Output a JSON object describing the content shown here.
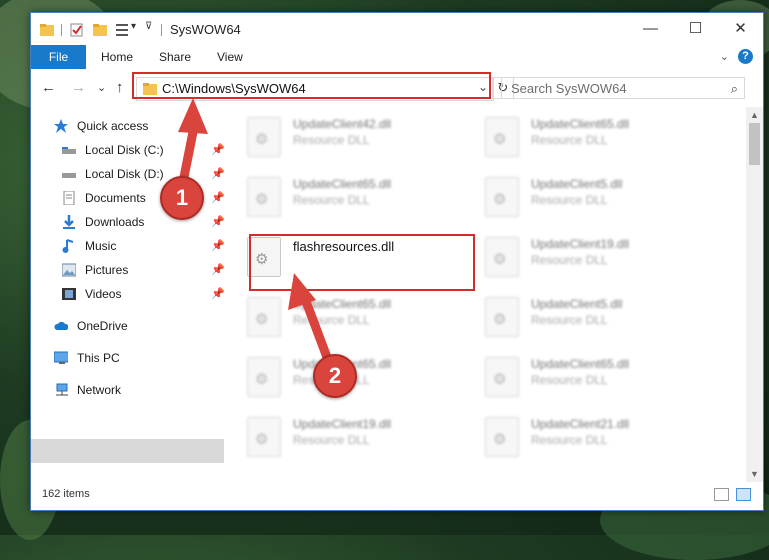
{
  "window": {
    "title": "SysWOW64",
    "min_glyph": "—",
    "max_glyph": "☐",
    "close_glyph": "✕"
  },
  "ribbon": {
    "tabs": [
      "File",
      "Home",
      "Share",
      "View"
    ],
    "help": "?",
    "collapse": "⌄"
  },
  "nav": {
    "back": "←",
    "forward": "→",
    "recent": "⌄",
    "up": "↑",
    "address": "C:\\Windows\\SysWOW64",
    "dropdown": "⌄",
    "refresh": "↻",
    "search_placeholder": "Search SysWOW64",
    "search_glyph": "⌕"
  },
  "sidebar": {
    "items": [
      {
        "label": "Quick access",
        "icon": "star-icon",
        "pinned": false
      },
      {
        "label": "Local Disk (C:)",
        "icon": "drive-icon",
        "pinned": true
      },
      {
        "label": "Local Disk (D:)",
        "icon": "drive-icon",
        "pinned": true
      },
      {
        "label": "Documents",
        "icon": "documents-icon",
        "pinned": true
      },
      {
        "label": "Downloads",
        "icon": "downloads-icon",
        "pinned": true
      },
      {
        "label": "Music",
        "icon": "music-icon",
        "pinned": true
      },
      {
        "label": "Pictures",
        "icon": "pictures-icon",
        "pinned": true
      },
      {
        "label": "Videos",
        "icon": "videos-icon",
        "pinned": true
      },
      {
        "label": "OneDrive",
        "icon": "cloud-icon",
        "pinned": false
      },
      {
        "label": "This PC",
        "icon": "computer-icon",
        "pinned": false,
        "selected": true
      },
      {
        "label": "Network",
        "icon": "network-icon",
        "pinned": false
      }
    ],
    "pin_glyph": "📌"
  },
  "files": [
    {
      "name": "UpdateClient42.dll",
      "type": "Resource DLL"
    },
    {
      "name": "UpdateClient65.dll",
      "type": "Resource DLL"
    },
    {
      "name": "UpdateClient65.dll",
      "type": "Resource DLL"
    },
    {
      "name": "UpdateClient5.dll",
      "type": "Resource DLL"
    },
    {
      "name": "flashresources.dll",
      "type": "",
      "highlight": true
    },
    {
      "name": "UpdateClient19.dll",
      "type": "Resource DLL"
    },
    {
      "name": "UpdateClient65.dll",
      "type": "Resource DLL"
    },
    {
      "name": "UpdateClient5.dll",
      "type": "Resource DLL"
    },
    {
      "name": "UpdateClient65.dll",
      "type": "Resource DLL"
    },
    {
      "name": "UpdateClient65.dll",
      "type": "Resource DLL"
    },
    {
      "name": "UpdateClient19.dll",
      "type": "Resource DLL"
    },
    {
      "name": "UpdateClient21.dll",
      "type": "Resource DLL"
    }
  ],
  "status": {
    "item_count": "162 items"
  },
  "callouts": [
    {
      "number": "1"
    },
    {
      "number": "2"
    }
  ],
  "colors": {
    "accent": "#1979ca",
    "highlight": "#d22d2d",
    "selected_nav": "#d9d9d9"
  }
}
